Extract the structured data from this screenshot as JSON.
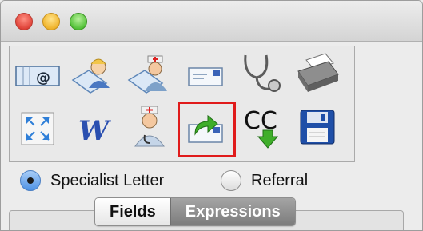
{
  "window": {
    "controls": [
      "close-button",
      "minimize-button",
      "zoom-button"
    ]
  },
  "toolbar": {
    "row1": [
      {
        "name": "email-card-icon",
        "text": "@"
      },
      {
        "name": "patient-card-icon"
      },
      {
        "name": "doctor-card-icon"
      },
      {
        "name": "envelope-icon"
      },
      {
        "name": "stethoscope-icon"
      },
      {
        "name": "printer-icon"
      }
    ],
    "row2": [
      {
        "name": "fullscreen-icon"
      },
      {
        "name": "word-icon",
        "text": "W"
      },
      {
        "name": "doctor-icon"
      },
      {
        "name": "forward-letter-icon",
        "highlighted": true
      },
      {
        "name": "cc-download-icon",
        "text": "CC"
      },
      {
        "name": "save-disk-icon"
      }
    ]
  },
  "letter_type": {
    "options": [
      {
        "label": "Specialist Letter",
        "selected": true
      },
      {
        "label": "Referral",
        "selected": false
      }
    ]
  },
  "tabs": [
    {
      "label": "Fields",
      "active": true
    },
    {
      "label": "Expressions",
      "active": false
    }
  ],
  "colors": {
    "highlight": "#e01b1b",
    "radio_selected": "#4f93e6",
    "forward_arrow": "#3fae2a"
  }
}
